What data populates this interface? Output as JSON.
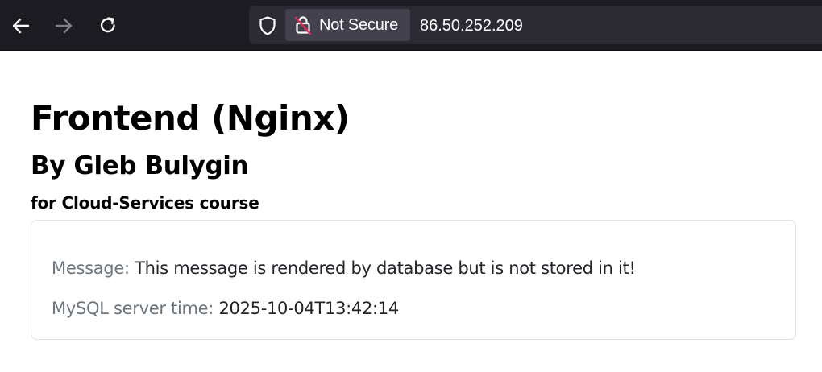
{
  "browser": {
    "nav": {
      "back_icon": "arrow-left-icon",
      "forward_icon": "arrow-right-icon",
      "reload_icon": "reload-icon"
    },
    "urlbar": {
      "shield_icon": "shield-icon",
      "lock_icon": "lock-slashed-icon",
      "security_label": "Not Secure",
      "url": "86.50.252.209"
    },
    "colors": {
      "toolbar_bg": "#1c1b22",
      "urlbar_bg": "#2b2a33",
      "pill_bg": "#42414d",
      "insecure_slash": "#e22850"
    }
  },
  "page": {
    "title": "Frontend (Nginx)",
    "author": "By Gleb Bulygin",
    "course": "for Cloud-Services course",
    "card": {
      "message_label": "Message:",
      "message_value": "This message is rendered by database but is not stored in it!",
      "time_label": "MySQL server time:",
      "time_value": "2025-10-04T13:42:14"
    }
  }
}
